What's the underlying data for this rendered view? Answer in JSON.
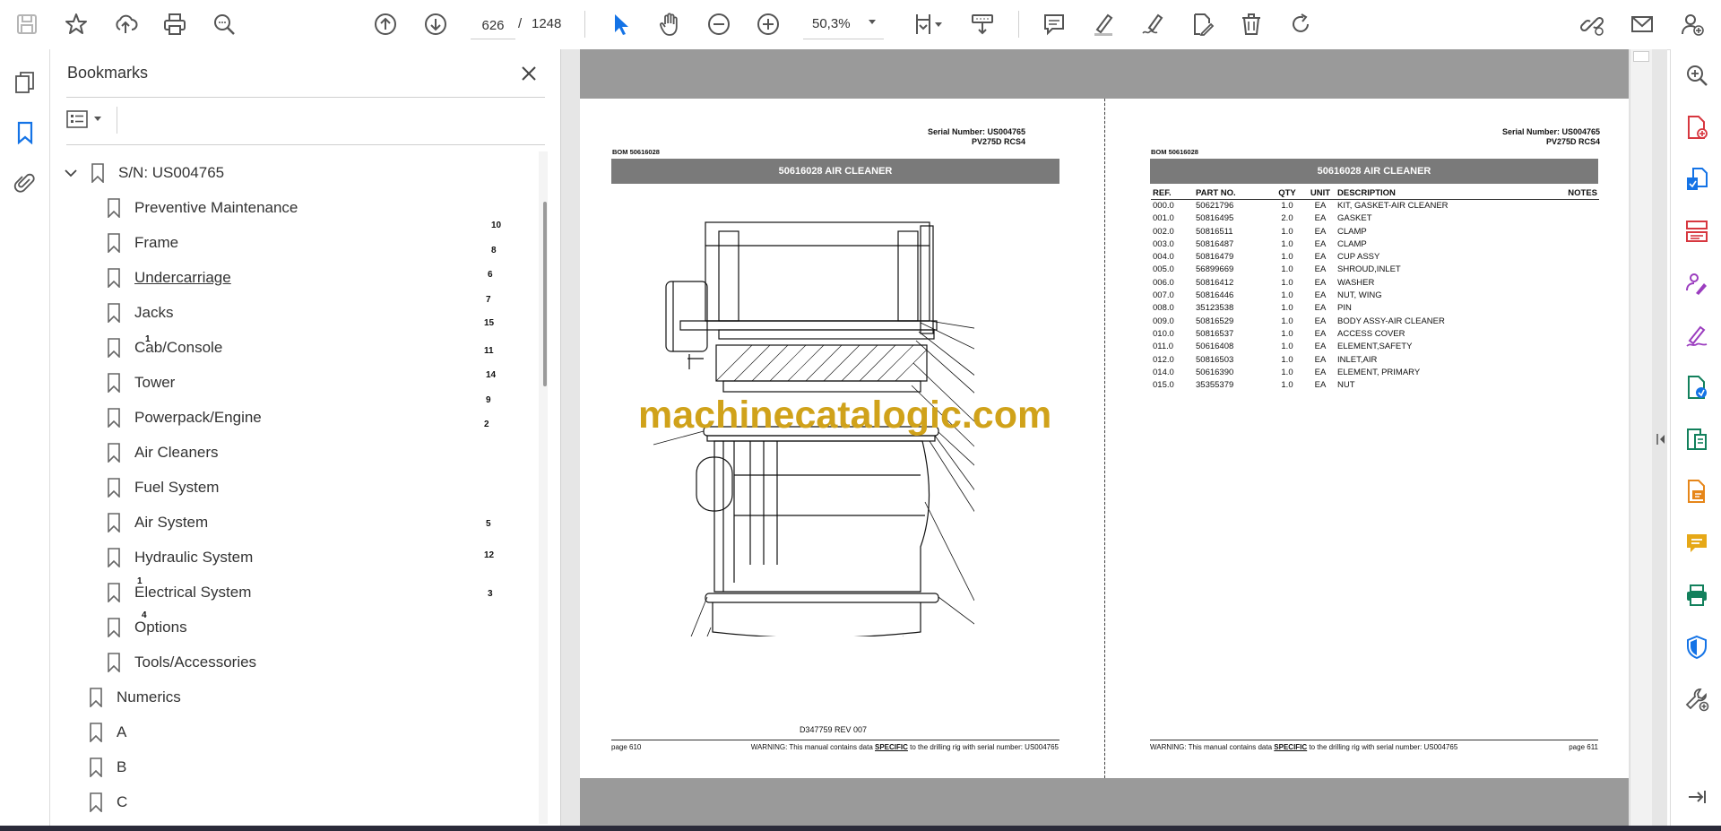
{
  "toolbar": {
    "current_page": "626",
    "page_separator": "/",
    "total_pages": "1248",
    "zoom": "50,3%",
    "icons": [
      "save-icon",
      "star-icon",
      "upload-icon",
      "print-icon",
      "search-icon",
      "page-up-icon",
      "page-down-icon",
      "select-arrow-icon",
      "hand-icon",
      "zoom-out-icon",
      "zoom-in-icon",
      "fit-page-icon",
      "scroll-mode-icon",
      "comment-icon",
      "highlight-icon",
      "sign-icon",
      "edit-pdf-icon",
      "delete-icon",
      "rotate-icon",
      "share-link-icon",
      "mail-icon",
      "account-icon"
    ],
    "accent_color": "#1473e6"
  },
  "bookmarks": {
    "title": "Bookmarks",
    "root": "S/N: US004765",
    "children": [
      "Preventive Maintenance",
      "Frame",
      "Undercarriage",
      "Jacks",
      "Cab/Console",
      "Tower",
      "Powerpack/Engine",
      "Air Cleaners",
      "Fuel System",
      "Air System",
      "Hydraulic System",
      "Electrical System",
      "Options",
      "Tools/Accessories"
    ],
    "siblings": [
      "Numerics",
      "A",
      "B",
      "C"
    ]
  },
  "doc": {
    "left_page": {
      "serial_line": "Serial Number: US004765",
      "model_line": "PV275D RCS4",
      "bom": "BOM 50616028",
      "title": "50616028 AIR CLEANER",
      "drawing_ref": "D347759 REV 007",
      "callouts": [
        "10",
        "8",
        "6",
        "7",
        "15",
        "1",
        "11",
        "14",
        "9",
        "2",
        "5",
        "12",
        "1",
        "4",
        "3"
      ],
      "page_label": "page 610",
      "warning_pre": "WARNING:  This manual contains data ",
      "warning_emph": "SPECIFIC",
      "warning_post": " to the drilling rig with serial number: US004765"
    },
    "right_page": {
      "serial_line": "Serial Number: US004765",
      "model_line": "PV275D RCS4",
      "bom": "BOM 50616028",
      "title": "50616028 AIR CLEANER",
      "page_label": "page 611",
      "warning_pre": "WARNING:  This manual contains data ",
      "warning_emph": "SPECIFIC",
      "warning_post": " to the drilling rig with serial number: US004765",
      "columns": [
        "REF.",
        "PART NO.",
        "QTY",
        "UNIT",
        "DESCRIPTION",
        "NOTES"
      ],
      "rows": [
        [
          "000.0",
          "50621796",
          "1.0",
          "EA",
          "KIT, GASKET-AIR CLEANER"
        ],
        [
          "001.0",
          "50816495",
          "2.0",
          "EA",
          "GASKET"
        ],
        [
          "002.0",
          "50816511",
          "1.0",
          "EA",
          "CLAMP"
        ],
        [
          "003.0",
          "50816487",
          "1.0",
          "EA",
          "CLAMP"
        ],
        [
          "004.0",
          "50816479",
          "1.0",
          "EA",
          "CUP ASSY"
        ],
        [
          "005.0",
          "56899669",
          "1.0",
          "EA",
          "SHROUD,INLET"
        ],
        [
          "006.0",
          "50816412",
          "1.0",
          "EA",
          "WASHER"
        ],
        [
          "007.0",
          "50816446",
          "1.0",
          "EA",
          "NUT, WING"
        ],
        [
          "008.0",
          "35123538",
          "1.0",
          "EA",
          "PIN"
        ],
        [
          "009.0",
          "50816529",
          "1.0",
          "EA",
          "BODY ASSY-AIR CLEANER"
        ],
        [
          "010.0",
          "50816537",
          "1.0",
          "EA",
          "ACCESS COVER"
        ],
        [
          "011.0",
          "50616408",
          "1.0",
          "EA",
          "ELEMENT,SAFETY"
        ],
        [
          "012.0",
          "50816503",
          "1.0",
          "EA",
          "INLET,AIR"
        ],
        [
          "014.0",
          "50616390",
          "1.0",
          "EA",
          "ELEMENT, PRIMARY"
        ],
        [
          "015.0",
          "35355379",
          "1.0",
          "EA",
          "NUT"
        ]
      ]
    },
    "watermark": "machinecatalogic.com"
  },
  "right_tools": {
    "icons": [
      "zoom-tool-icon",
      "create-pdf-icon",
      "export-pdf-icon",
      "organize-pages-icon",
      "fill-sign-icon",
      "edit-text-icon",
      "convert-pdf-icon",
      "compress-pdf-icon",
      "combine-files-icon",
      "add-comment-icon",
      "print-production-icon",
      "protect-icon",
      "more-tools-icon",
      "expand-panel-icon"
    ]
  }
}
